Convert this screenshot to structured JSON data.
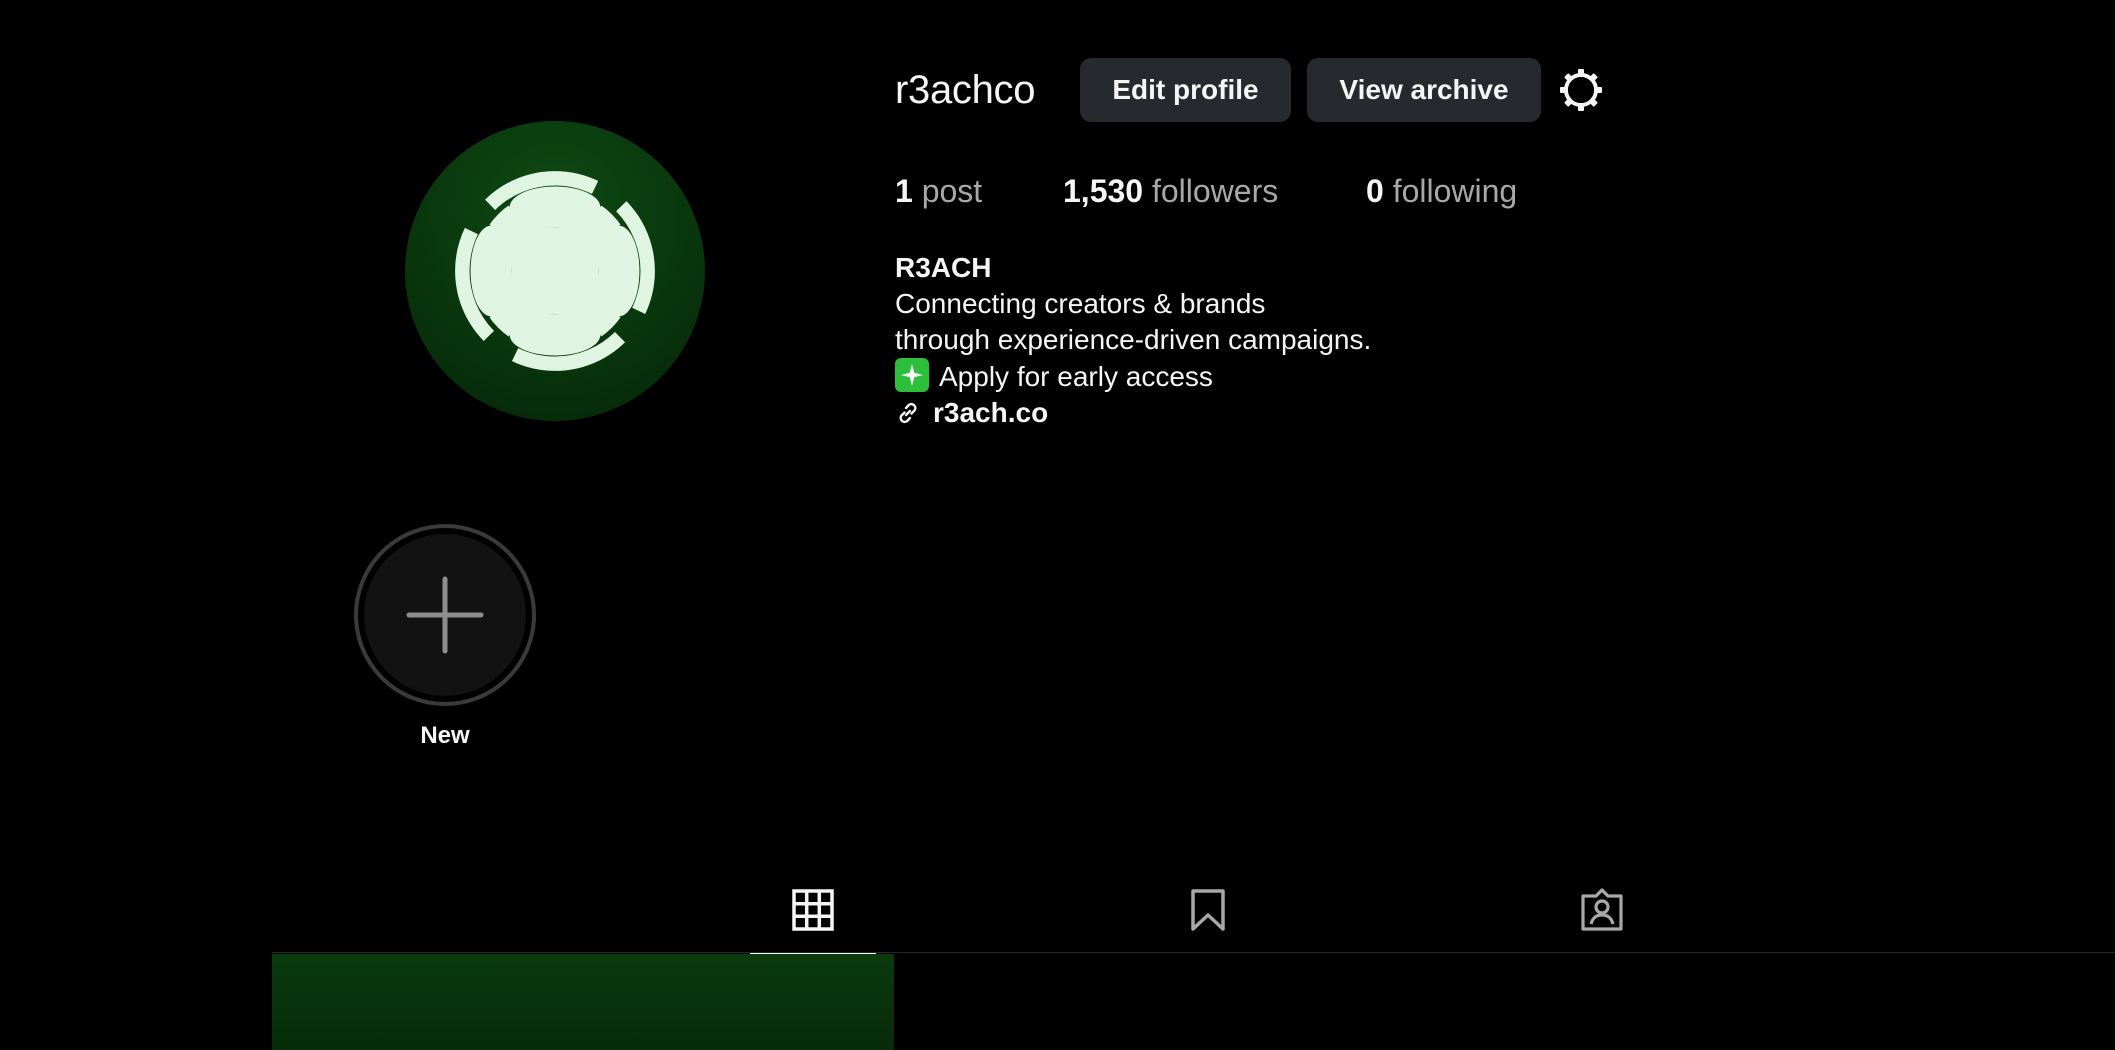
{
  "profile": {
    "username": "r3achco",
    "edit_label": "Edit profile",
    "archive_label": "View archive"
  },
  "stats": {
    "posts_count": "1",
    "posts_label": "post",
    "followers_count": "1,530",
    "followers_label": "followers",
    "following_count": "0",
    "following_label": "following"
  },
  "bio": {
    "name": "R3ACH",
    "line1": "Connecting creators & brands",
    "line2": "through experience-driven campaigns.",
    "line3": "Apply for early access",
    "link": "r3ach.co"
  },
  "highlights": {
    "new_label": "New"
  },
  "tabs": [
    {
      "id": "posts",
      "icon": "grid-icon",
      "active": true
    },
    {
      "id": "saved",
      "icon": "bookmark-icon",
      "active": false
    },
    {
      "id": "tagged",
      "icon": "tagged-user-icon",
      "active": false
    }
  ],
  "colors": {
    "background": "#000000",
    "button_bg": "#26292d",
    "brand_green": "#0a3a0e",
    "logo_mint": "#dff5e1",
    "sparkle_green": "#2bbf3a",
    "muted_text": "#a8a8a8"
  },
  "icons": {
    "settings": "gear-icon",
    "link": "link-icon",
    "plus": "plus-icon",
    "sparkle": "sparkle-icon"
  }
}
